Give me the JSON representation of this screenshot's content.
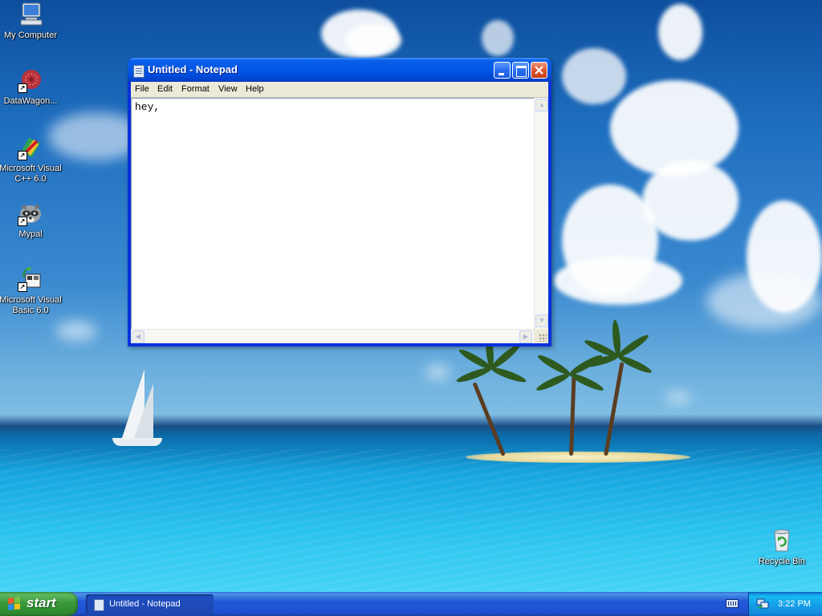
{
  "desktop": {
    "icons": [
      {
        "label": "My Computer"
      },
      {
        "label": "DataWagon..."
      },
      {
        "label": "Microsoft Visual C++ 6.0"
      },
      {
        "label": "Mypal"
      },
      {
        "label": "Microsoft Visual Basic 6.0"
      },
      {
        "label": "Recycle Bin"
      }
    ]
  },
  "notepad": {
    "title": "Untitled - Notepad",
    "menu": [
      "File",
      "Edit",
      "Format",
      "View",
      "Help"
    ],
    "content": "hey,"
  },
  "taskbar": {
    "start_label": "start",
    "task_label": "Untitled - Notepad",
    "clock": "3:22 PM"
  },
  "colors": {
    "titlebar_blue": "#0058e6",
    "close_red": "#e2582f",
    "start_green": "#3a9a3a",
    "taskbar_blue": "#2157d7"
  }
}
